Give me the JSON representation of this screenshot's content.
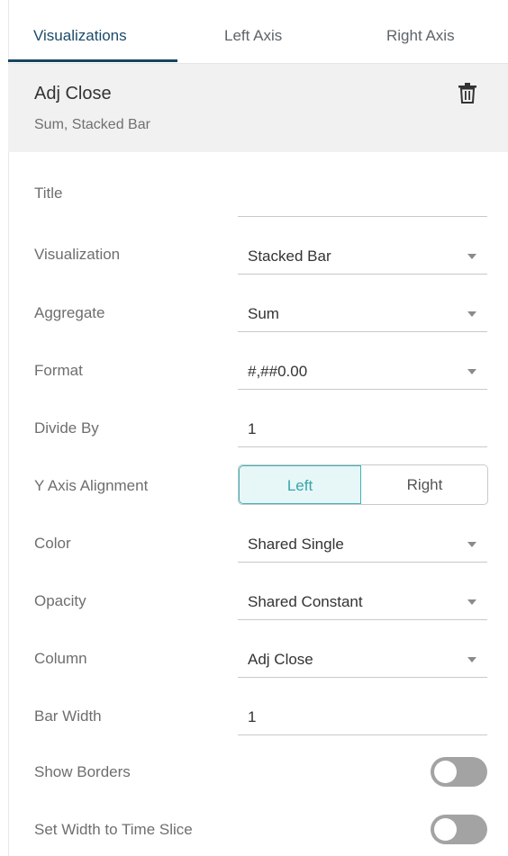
{
  "tabs": [
    "Visualizations",
    "Left Axis",
    "Right Axis"
  ],
  "header": {
    "title": "Adj Close",
    "subtitle": "Sum, Stacked Bar",
    "delete_icon": "trash-icon"
  },
  "fields": {
    "title": {
      "label": "Title",
      "value": ""
    },
    "visualization": {
      "label": "Visualization",
      "value": "Stacked Bar"
    },
    "aggregate": {
      "label": "Aggregate",
      "value": "Sum"
    },
    "format": {
      "label": "Format",
      "value": "#,##0.00"
    },
    "divide_by": {
      "label": "Divide By",
      "value": "1"
    },
    "y_axis_alignment": {
      "label": "Y Axis Alignment",
      "options": [
        "Left",
        "Right"
      ],
      "selected": "Left"
    },
    "color": {
      "label": "Color",
      "value": "Shared Single"
    },
    "opacity": {
      "label": "Opacity",
      "value": "Shared Constant"
    },
    "column": {
      "label": "Column",
      "value": "Adj Close"
    },
    "bar_width": {
      "label": "Bar Width",
      "value": "1"
    },
    "show_borders": {
      "label": "Show Borders",
      "on": false
    },
    "set_width_time_slice": {
      "label": "Set Width to Time Slice",
      "on": false
    }
  },
  "colors": {
    "accent": "#3fb3b8",
    "tab_active": "#17455f",
    "toggle_off": "#a3a3a3"
  }
}
